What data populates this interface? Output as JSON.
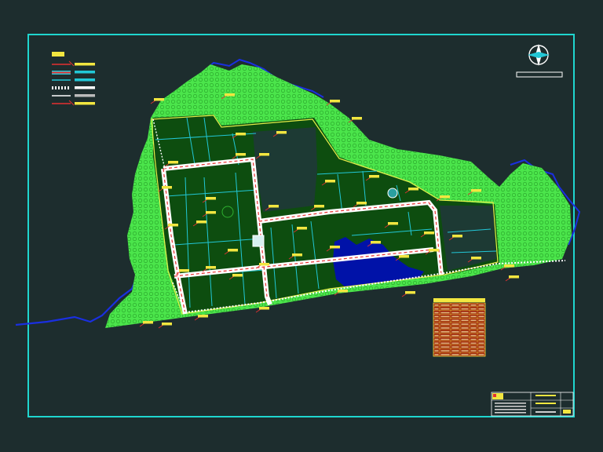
{
  "colors": {
    "background": "#1d2d2e",
    "frame": "#1fd6cf",
    "forest": "#4be54b",
    "field": "#0d4d0f",
    "road": "#ffffff",
    "road_marking": "#e53030",
    "boundary": "#e6ef4a",
    "lake": "#0012a8",
    "river": "#1a2fe0",
    "canal": "#22c7d6",
    "label": "#f2e640",
    "table_fill": "#a0260f",
    "table_grid": "#f2e640"
  },
  "icons": {
    "north_arrow": "compass-rose-icon"
  },
  "legend": {
    "rows": [
      {
        "symbol": "boundary-line-red-yellow"
      },
      {
        "symbol": "road-band-multicolor"
      },
      {
        "symbol": "canal-line-cyan"
      },
      {
        "symbol": "road-dotted-white"
      },
      {
        "symbol": "path-white"
      },
      {
        "symbol": "drain-red-yellow"
      }
    ]
  },
  "data_table": {
    "rows": 14,
    "cols": 6
  },
  "title_block": {
    "cells": 9
  }
}
